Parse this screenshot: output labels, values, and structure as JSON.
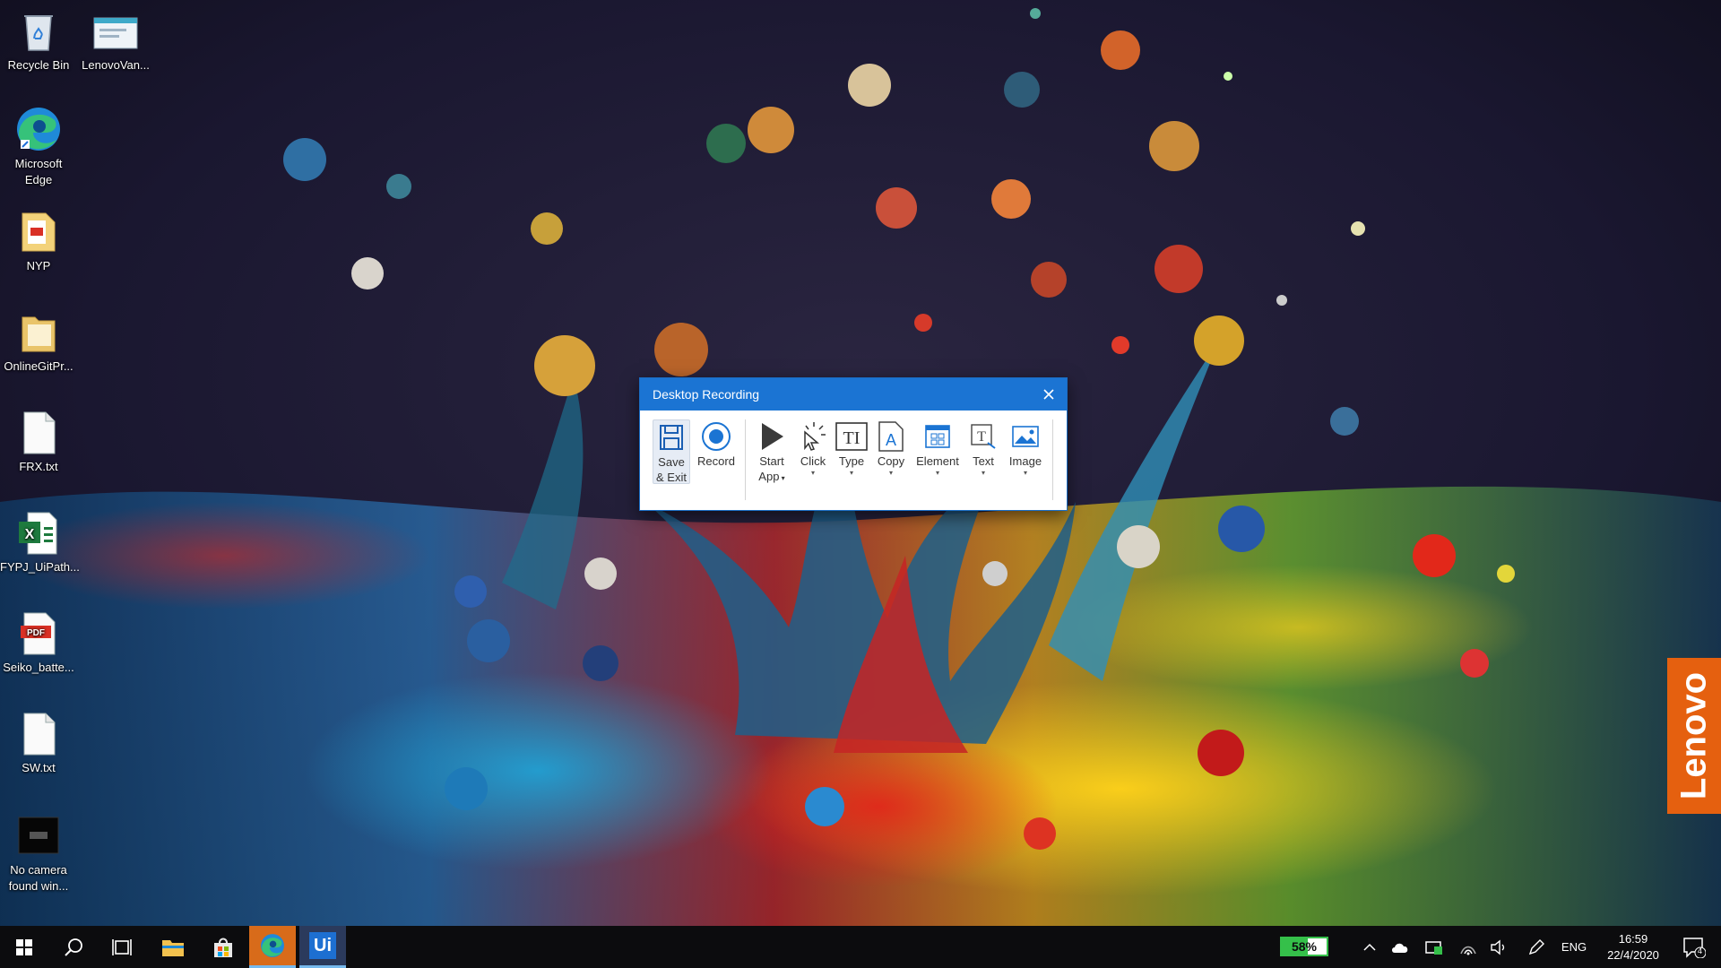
{
  "desktop": {
    "icons": [
      {
        "label": "Recycle Bin",
        "icon": "recycle-bin-icon"
      },
      {
        "label": "LenovoVan...",
        "icon": "window-shortcut-icon"
      },
      {
        "label": "Microsoft Edge",
        "icon": "edge-icon"
      },
      {
        "label": "NYP",
        "icon": "folder-pdf-icon"
      },
      {
        "label": "OnlineGitPr...",
        "icon": "folder-icon"
      },
      {
        "label": "FRX.txt",
        "icon": "text-file-icon"
      },
      {
        "label": "FYPJ_UiPath...",
        "icon": "excel-file-icon"
      },
      {
        "label": "Seiko_batte...",
        "icon": "pdf-file-icon"
      },
      {
        "label": "SW.txt",
        "icon": "text-file-icon"
      },
      {
        "label": "No camera found win...",
        "icon": "screenshot-icon"
      }
    ],
    "brand_tab": "Lenovo",
    "brand_color": "#e5600f"
  },
  "recording_dialog": {
    "title": "Desktop Recording",
    "accent": "#1b74d3",
    "buttons": [
      {
        "id": "save-exit",
        "label_line1": "Save",
        "label_line2": "& Exit",
        "icon": "floppy-disk-icon"
      },
      {
        "id": "record",
        "label_line1": "Record",
        "icon": "record-icon"
      },
      {
        "id": "start-app",
        "label_line1": "Start",
        "label_line2": "App",
        "icon": "play-icon",
        "has_dropdown": true
      },
      {
        "id": "click",
        "label_line1": "Click",
        "icon": "cursor-click-icon",
        "has_dropdown": true
      },
      {
        "id": "type",
        "label_line1": "Type",
        "icon": "type-text-icon",
        "has_dropdown": true
      },
      {
        "id": "copy",
        "label_line1": "Copy",
        "icon": "copy-text-icon",
        "has_dropdown": true
      },
      {
        "id": "element",
        "label_line1": "Element",
        "icon": "element-icon",
        "has_dropdown": true
      },
      {
        "id": "text",
        "label_line1": "Text",
        "icon": "text-icon",
        "has_dropdown": true
      },
      {
        "id": "image",
        "label_line1": "Image",
        "icon": "image-icon",
        "has_dropdown": true
      }
    ]
  },
  "taskbar": {
    "apps": [
      "windows-start-icon",
      "search-icon",
      "task-view-icon",
      "file-explorer-icon",
      "store-icon",
      "edge-icon",
      "uipath-icon"
    ],
    "uipath_label": "Ui",
    "battery_percent": 58,
    "battery_label": "58%",
    "language": "ENG",
    "time": "16:59",
    "date": "22/4/2020",
    "notification_count": "4"
  }
}
